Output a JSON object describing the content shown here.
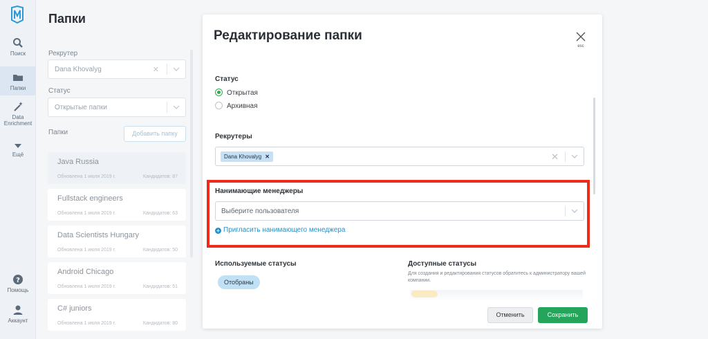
{
  "nav": {
    "items": [
      {
        "label": "Поиск",
        "icon": "search-icon"
      },
      {
        "label": "Папки",
        "icon": "folder-icon"
      },
      {
        "label": "Data Enrichment",
        "icon": "magic-wand-icon"
      },
      {
        "label": "Ещё",
        "icon": "chevron-down-icon"
      },
      {
        "label": "Помощь",
        "icon": "help-icon"
      },
      {
        "label": "Аккаунт",
        "icon": "user-icon"
      }
    ]
  },
  "folders_panel": {
    "title": "Папки",
    "recruiter_label": "Рекрутер",
    "recruiter_value": "Dana Khovalyg",
    "status_label": "Статус",
    "status_value": "Открытые папки",
    "folders_label": "Папки",
    "add_folder_button": "Добавить папку",
    "folders": [
      {
        "name": "Java Russia",
        "updated": "Обновлена 1 июля 2019 г.",
        "count": "Кандидатов: 87"
      },
      {
        "name": "Fullstack engineers",
        "updated": "Обновлена 1 июля 2019 г.",
        "count": "Кандидатов: 63"
      },
      {
        "name": "Data Scientists Hungary",
        "updated": "Обновлена 1 июля 2019 г.",
        "count": "Кандидатов: 50"
      },
      {
        "name": "Android Chicago",
        "updated": "Обновлена 1 июля 2019 г.",
        "count": "Кандидатов: 51"
      },
      {
        "name": "C# juniors",
        "updated": "Обновлена 1 июля 2019 г.",
        "count": "Кандидатов: 80"
      }
    ]
  },
  "modal": {
    "title": "Редактирование папки",
    "close_hint": "esc",
    "status_heading": "Статус",
    "status_options": [
      {
        "label": "Открытая",
        "selected": true
      },
      {
        "label": "Архивная",
        "selected": false
      }
    ],
    "recruiters_heading": "Рекрутеры",
    "recruiter_tag": "Dana Khovalyg",
    "managers_heading": "Нанимающие менеджеры",
    "managers_placeholder": "Выберите пользователя",
    "invite_link": "Пригласить нанимающего менеджера",
    "used_statuses_heading": "Используемые статусы",
    "used_status_pill": "Отобраны",
    "available_statuses_heading": "Доступные статусы",
    "available_statuses_desc": "Для создания и редактирования статусов обратитесь к администратору вашей компании.",
    "cancel_button": "Отменить",
    "save_button": "Сохранить"
  },
  "colors": {
    "accent_green": "#25a55b",
    "link_blue": "#2c8fc7",
    "highlight_red": "#ee2a1d"
  }
}
